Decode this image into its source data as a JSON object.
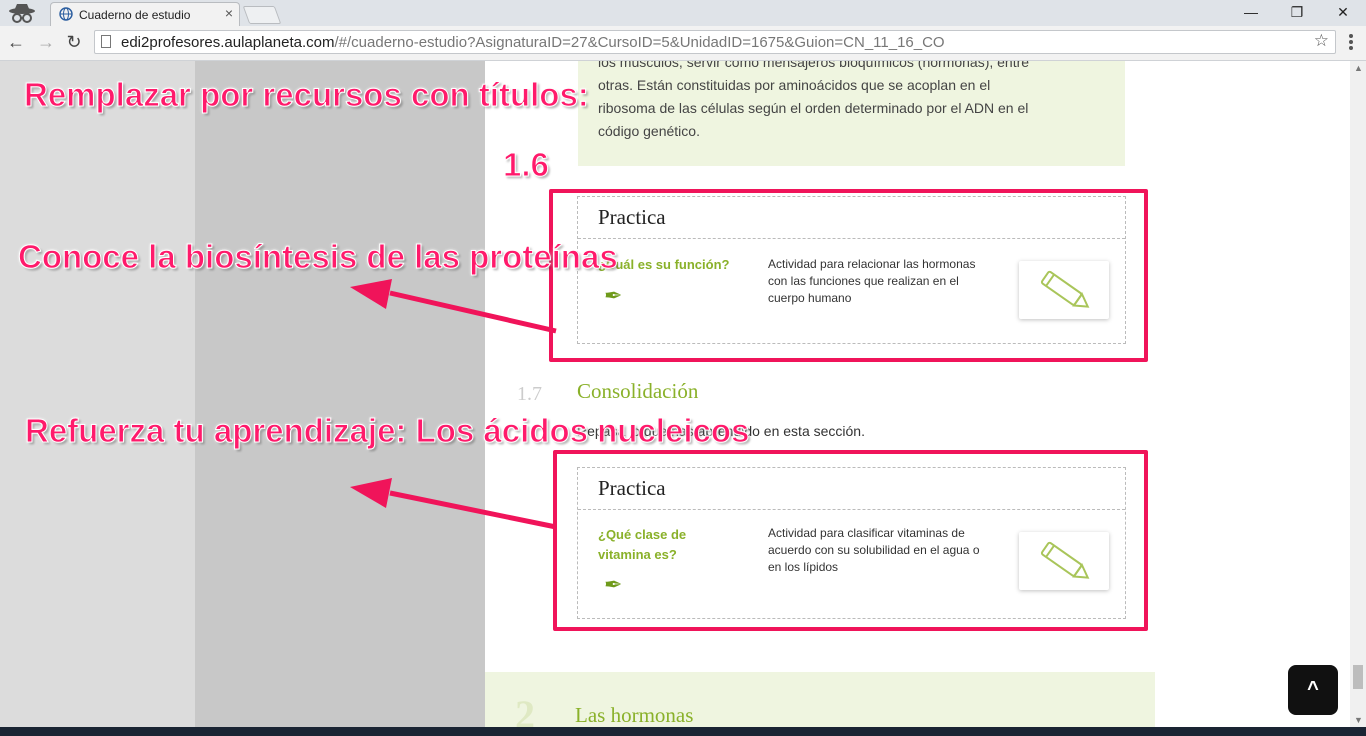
{
  "browser": {
    "tab_title": "Cuaderno de estudio",
    "tab_close": "×",
    "url_host": "edi2profesores.aulaplaneta.com",
    "url_path": "/#/cuaderno-estudio?AsignaturaID=27&CursoID=5&UnidadID=1675&Guion=CN_11_16_CO",
    "back": "←",
    "forward": "→",
    "reload": "↻",
    "star": "☆",
    "minimize": "—",
    "restore": "❐",
    "close": "✕"
  },
  "page": {
    "intro_text": "los músculos, servir como mensajeros bioquímicos (hormonas), entre otras. Están constituidas por aminoácidos que se acoplan en el ribosoma de las células según el orden determinado por el ADN en el código genético.",
    "card1": {
      "header": "Practica",
      "resource_title": "¿Cuál es su función?",
      "description": "Actividad para relacionar las hormonas con las funciones que realizan en el cuerpo humano"
    },
    "section": {
      "number": "1.7",
      "title": "Consolidación",
      "text": "Repasa lo que has aprendido en esta sección."
    },
    "card2": {
      "header": "Practica",
      "resource_title": "¿Qué clase de vitamina es?",
      "description": "Actividad para clasificar vitaminas de acuerdo con su solubilidad en el agua o en los lípidos"
    },
    "next_section": {
      "number": "2",
      "title": "Las hormonas"
    },
    "scroll_top": "^"
  },
  "annotations": {
    "replace_title": "Remplazar por recursos con títulos:",
    "label_16": "1.6",
    "label_resource1": "Conoce la biosíntesis de las proteínas",
    "label_resource2": "Refuerza tu aprendizaje: Los ácidos nucleicos"
  },
  "colors": {
    "accent_green": "#8ab12a",
    "annotation_pink": "#ff1a6b",
    "box_border": "#f0145a"
  }
}
